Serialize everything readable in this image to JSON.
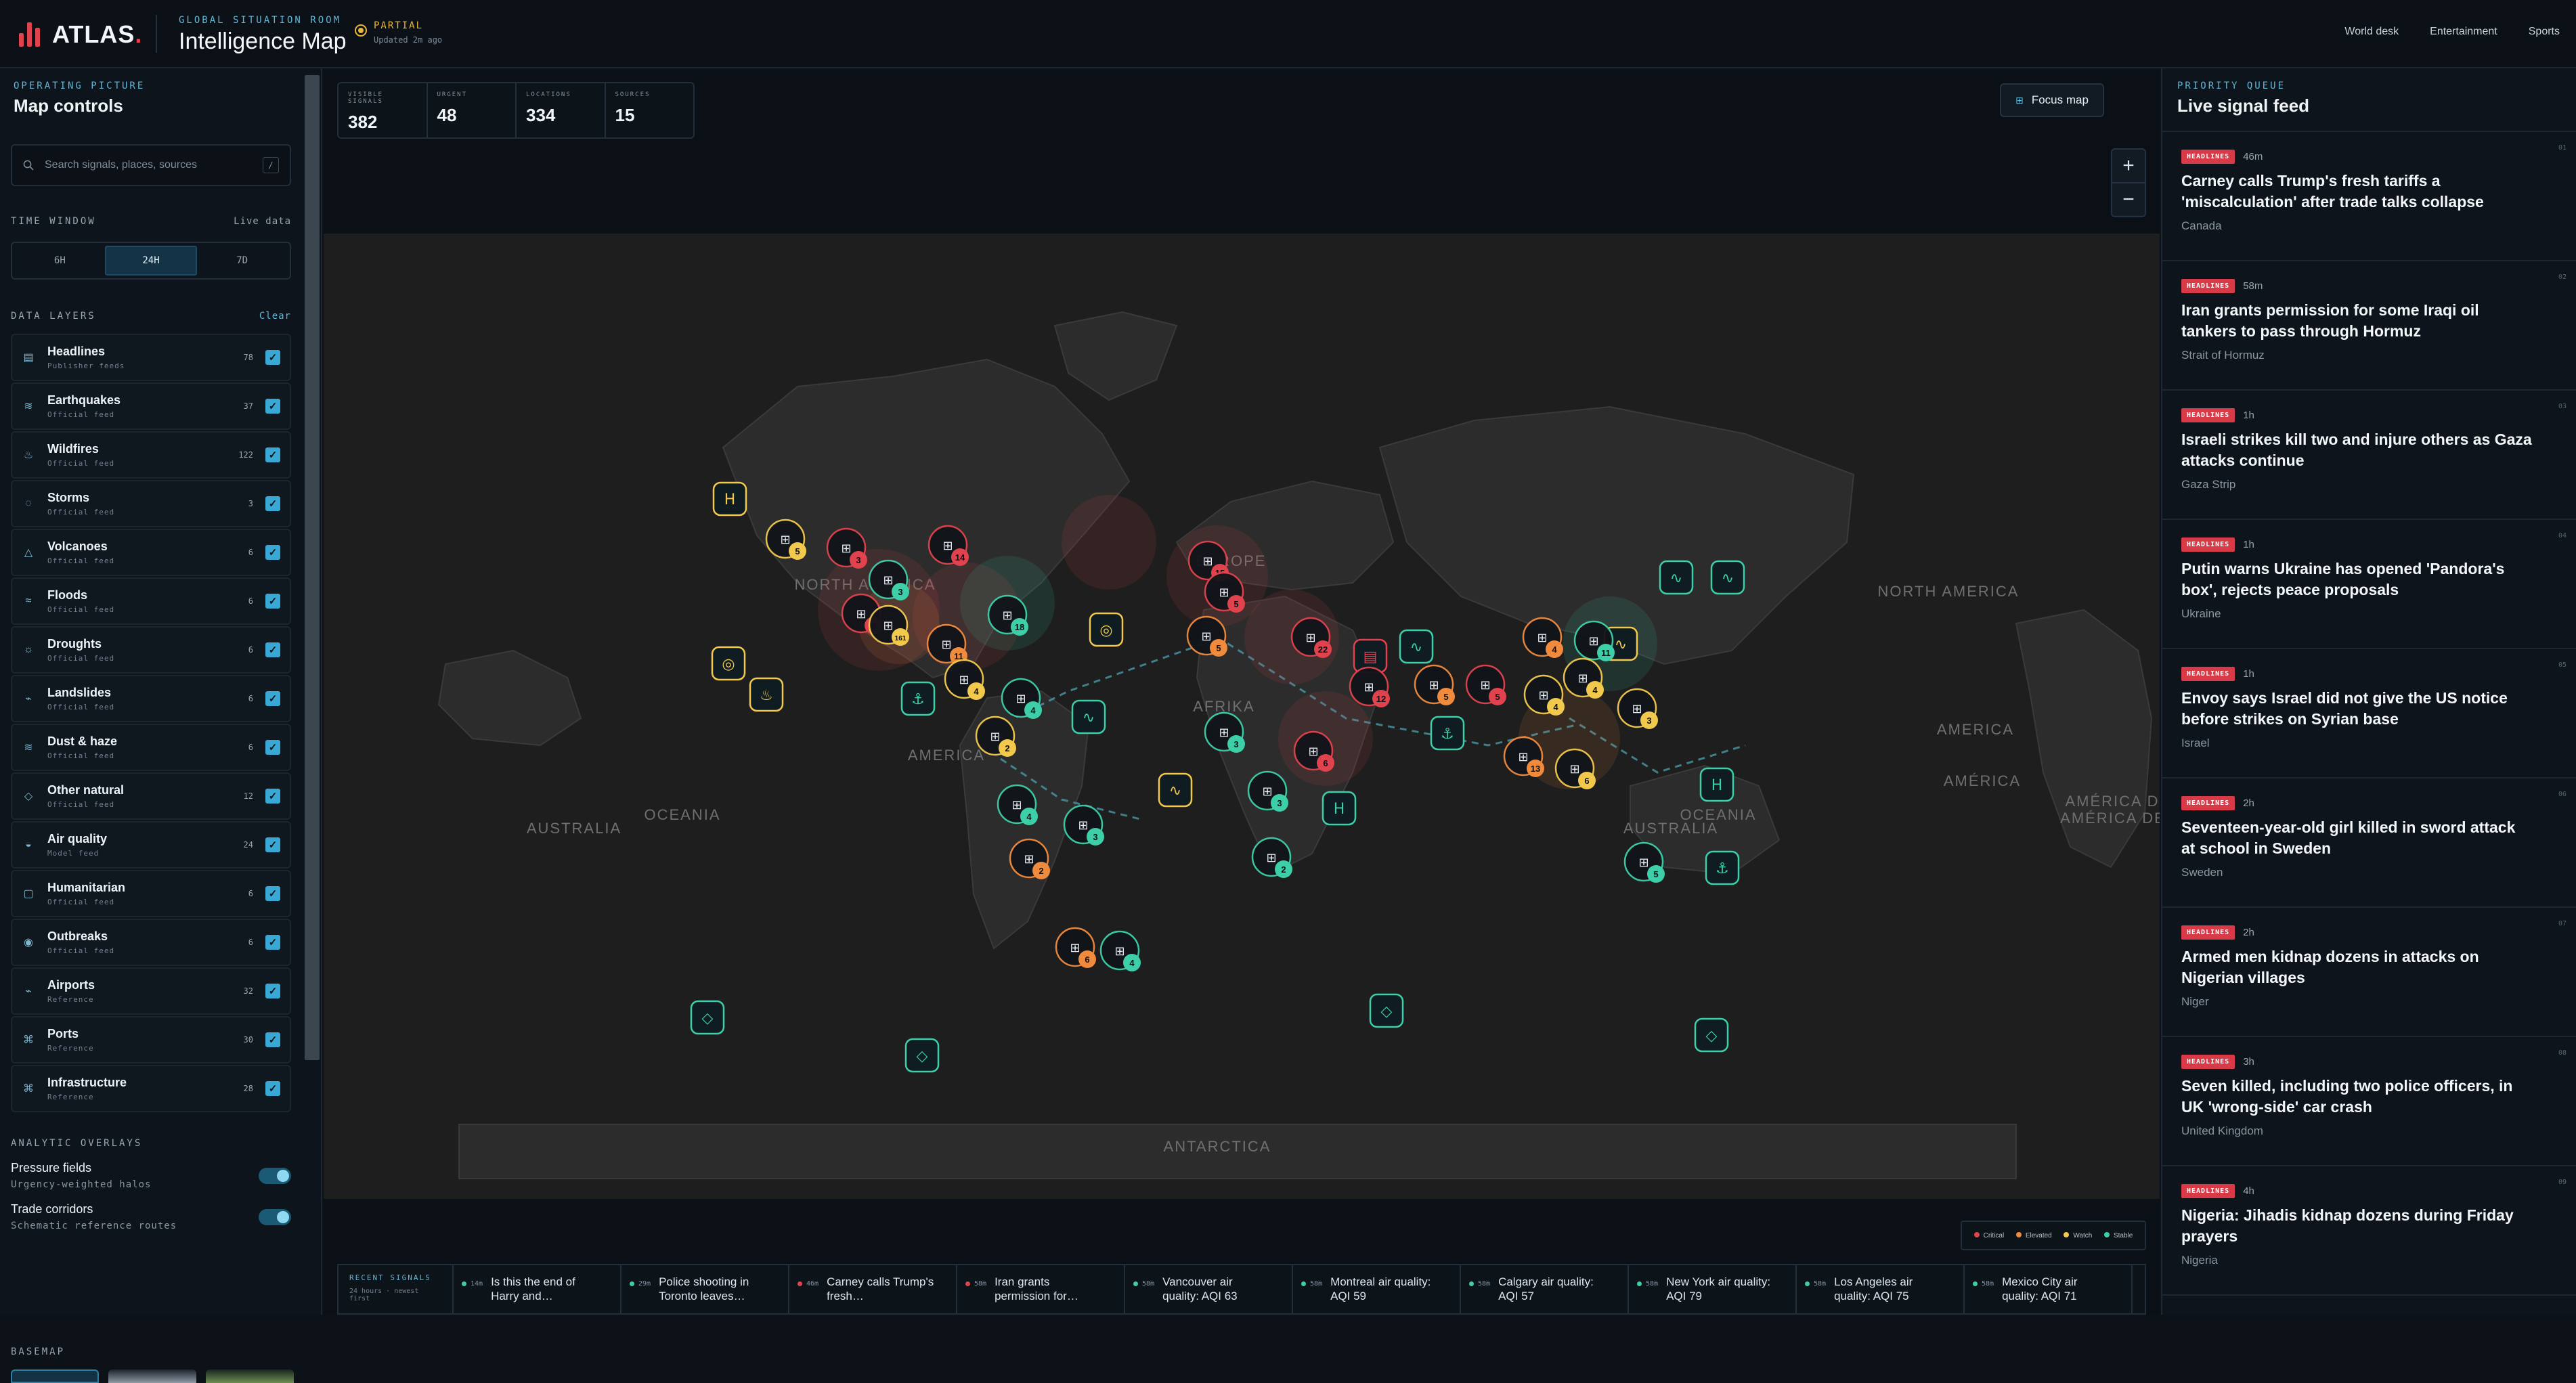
{
  "brand": {
    "name": "ATLAS",
    "dot": "."
  },
  "header": {
    "eyebrow": "GLOBAL SITUATION ROOM",
    "title": "Intelligence Map",
    "status_label": "PARTIAL",
    "status_time": "Updated 2m ago"
  },
  "nav": [
    "World desk",
    "Entertainment",
    "Sports"
  ],
  "sidebar": {
    "eyebrow": "OPERATING PICTURE",
    "title": "Map controls",
    "search_placeholder": "Search signals, places, sources",
    "search_shortcut": "/",
    "time_window": {
      "label": "TIME WINDOW",
      "right": "Live data",
      "options": [
        "6H",
        "24H",
        "7D"
      ],
      "selected": "24H"
    },
    "data_layers": {
      "label": "DATA LAYERS",
      "action": "Clear"
    },
    "layers": [
      {
        "name": "Headlines",
        "sub": "Publisher feeds",
        "count": "78",
        "icon": "newspaper-icon",
        "glyph": "▤"
      },
      {
        "name": "Earthquakes",
        "sub": "Official feed",
        "count": "37",
        "icon": "seismic-icon",
        "glyph": "≋"
      },
      {
        "name": "Wildfires",
        "sub": "Official feed",
        "count": "122",
        "icon": "flame-icon",
        "glyph": "♨"
      },
      {
        "name": "Storms",
        "sub": "Official feed",
        "count": "3",
        "icon": "cyclone-icon",
        "glyph": "◌"
      },
      {
        "name": "Volcanoes",
        "sub": "Official feed",
        "count": "6",
        "icon": "volcano-icon",
        "glyph": "△"
      },
      {
        "name": "Floods",
        "sub": "Official feed",
        "count": "6",
        "icon": "waves-icon",
        "glyph": "≈"
      },
      {
        "name": "Droughts",
        "sub": "Official feed",
        "count": "6",
        "icon": "sun-icon",
        "glyph": "☼"
      },
      {
        "name": "Landslides",
        "sub": "Official feed",
        "count": "6",
        "icon": "landslide-icon",
        "glyph": "⌁"
      },
      {
        "name": "Dust & haze",
        "sub": "Official feed",
        "count": "6",
        "icon": "haze-icon",
        "glyph": "≋"
      },
      {
        "name": "Other natural",
        "sub": "Official feed",
        "count": "12",
        "icon": "diamond-icon",
        "glyph": "◇"
      },
      {
        "name": "Air quality",
        "sub": "Model feed",
        "count": "24",
        "icon": "air-quality-icon",
        "glyph": "◒"
      },
      {
        "name": "Humanitarian",
        "sub": "Official feed",
        "count": "6",
        "icon": "humanitarian-icon",
        "glyph": "▢"
      },
      {
        "name": "Outbreaks",
        "sub": "Official feed",
        "count": "6",
        "icon": "outbreak-icon",
        "glyph": "◉"
      },
      {
        "name": "Airports",
        "sub": "Reference",
        "count": "32",
        "icon": "airport-icon",
        "glyph": "⌁"
      },
      {
        "name": "Ports",
        "sub": "Reference",
        "count": "30",
        "icon": "port-icon",
        "glyph": "⌘"
      },
      {
        "name": "Infrastructure",
        "sub": "Reference",
        "count": "28",
        "icon": "infrastructure-icon",
        "glyph": "⌘"
      }
    ],
    "overlays_label": "ANALYTIC OVERLAYS",
    "overlays": [
      {
        "name": "Pressure fields",
        "sub": "Urgency-weighted halos"
      },
      {
        "name": "Trade corridors",
        "sub": "Schematic reference routes"
      }
    ],
    "basemap_label": "BASEMAP"
  },
  "stats": [
    {
      "label": "VISIBLE SIGNALS",
      "value": "382"
    },
    {
      "label": "URGENT",
      "value": "48"
    },
    {
      "label": "LOCATIONS",
      "value": "334"
    },
    {
      "label": "SOURCES",
      "value": "15"
    }
  ],
  "map": {
    "focus_label": "Focus map",
    "zoom_in": "+",
    "zoom_out": "−",
    "region_labels": [
      "NORTH AMERICA",
      "NORTH AMERICA",
      "AUSTRALIA",
      "OCEANIA",
      "AUSTRALIA",
      "OCEANIA",
      "AMERICA",
      "AMÉRICA DO SUL",
      "AMÉRICA DEL SUR",
      "ANTARCTICA",
      "EUROPE",
      "AFRIKA",
      "AMERICA",
      "AMÉRICA"
    ],
    "legend": [
      {
        "label": "Critical",
        "color": "#e0434e"
      },
      {
        "label": "Elevated",
        "color": "#f08a3c"
      },
      {
        "label": "Watch",
        "color": "#f2c94c"
      },
      {
        "label": "Stable",
        "color": "#3ccfa8"
      }
    ]
  },
  "ticker": {
    "label": "RECENT SIGNALS",
    "sub": "24 hours · newest first",
    "items": [
      {
        "age": "14m",
        "text": "Is this the end of Harry and…",
        "color": "#3ccfa8"
      },
      {
        "age": "29m",
        "text": "Police shooting in Toronto leaves…",
        "color": "#3ccfa8"
      },
      {
        "age": "46m",
        "text": "Carney calls Trump's fresh…",
        "color": "#e0434e"
      },
      {
        "age": "58m",
        "text": "Iran grants permission for…",
        "color": "#e0434e"
      },
      {
        "age": "58m",
        "text": "Vancouver air quality: AQI 63",
        "color": "#3ccfa8"
      },
      {
        "age": "58m",
        "text": "Montreal air quality: AQI 59",
        "color": "#3ccfa8"
      },
      {
        "age": "58m",
        "text": "Calgary air quality: AQI 57",
        "color": "#3ccfa8"
      },
      {
        "age": "58m",
        "text": "New York air quality: AQI 79",
        "color": "#3ccfa8"
      },
      {
        "age": "58m",
        "text": "Los Angeles air quality: AQI 75",
        "color": "#3ccfa8"
      },
      {
        "age": "58m",
        "text": "Mexico City air quality: AQI 71",
        "color": "#3ccfa8"
      }
    ]
  },
  "feed": {
    "eyebrow": "PRIORITY QUEUE",
    "title": "Live signal feed",
    "items": [
      {
        "num": "01",
        "badge": "HEADLINES",
        "age": "46m",
        "headline": "Carney calls Trump's fresh tariffs a 'miscalculation' after trade talks collapse",
        "location": "Canada"
      },
      {
        "num": "02",
        "badge": "HEADLINES",
        "age": "58m",
        "headline": "Iran grants permission for some Iraqi oil tankers to pass through Hormuz",
        "location": "Strait of Hormuz"
      },
      {
        "num": "03",
        "badge": "HEADLINES",
        "age": "1h",
        "headline": "Israeli strikes kill two and injure others as Gaza attacks continue",
        "location": "Gaza Strip"
      },
      {
        "num": "04",
        "badge": "HEADLINES",
        "age": "1h",
        "headline": "Putin warns Ukraine has opened 'Pandora's box', rejects peace proposals",
        "location": "Ukraine"
      },
      {
        "num": "05",
        "badge": "HEADLINES",
        "age": "1h",
        "headline": "Envoy says Israel did not give the US notice before strikes on Syrian base",
        "location": "Israel"
      },
      {
        "num": "06",
        "badge": "HEADLINES",
        "age": "2h",
        "headline": "Seventeen-year-old girl killed in sword attack at school in Sweden",
        "location": "Sweden"
      },
      {
        "num": "07",
        "badge": "HEADLINES",
        "age": "2h",
        "headline": "Armed men kidnap dozens in attacks on Nigerian villages",
        "location": "Niger"
      },
      {
        "num": "08",
        "badge": "HEADLINES",
        "age": "3h",
        "headline": "Seven killed, including two police officers, in UK 'wrong-side' car crash",
        "location": "United Kingdom"
      },
      {
        "num": "09",
        "badge": "HEADLINES",
        "age": "4h",
        "headline": "Nigeria: Jihadis kidnap dozens during Friday prayers",
        "location": "Nigeria"
      }
    ]
  },
  "markers": [
    {
      "count": "5",
      "sev": "watch"
    },
    {
      "count": "3",
      "sev": "critical"
    },
    {
      "count": "3",
      "sev": "stable"
    },
    {
      "count": "14",
      "sev": "critical"
    },
    {
      "count": "3",
      "sev": "critical"
    },
    {
      "count": "161",
      "sev": "watch"
    },
    {
      "count": "11",
      "sev": "elevated"
    },
    {
      "count": "18",
      "sev": "stable"
    },
    {
      "count": "4",
      "sev": "watch"
    },
    {
      "count": "4",
      "sev": "stable"
    },
    {
      "count": "2",
      "sev": "watch"
    },
    {
      "count": "4",
      "sev": "stable"
    },
    {
      "count": "3",
      "sev": "stable"
    },
    {
      "count": "2",
      "sev": "elevated"
    },
    {
      "count": "6",
      "sev": "elevated"
    },
    {
      "count": "4",
      "sev": "stable"
    },
    {
      "count": "15",
      "sev": "critical"
    },
    {
      "count": "5",
      "sev": "critical"
    },
    {
      "count": "5",
      "sev": "elevated"
    },
    {
      "count": "22",
      "sev": "critical"
    },
    {
      "count": "3",
      "sev": "stable"
    },
    {
      "count": "6",
      "sev": "critical"
    },
    {
      "count": "3",
      "sev": "stable"
    },
    {
      "count": "2",
      "sev": "stable"
    },
    {
      "count": "12",
      "sev": "critical"
    },
    {
      "count": "5",
      "sev": "elevated"
    },
    {
      "count": "5",
      "sev": "critical"
    },
    {
      "count": "4",
      "sev": "elevated"
    },
    {
      "count": "4",
      "sev": "watch"
    },
    {
      "count": "11",
      "sev": "stable"
    },
    {
      "count": "4",
      "sev": "watch"
    },
    {
      "count": "3",
      "sev": "watch"
    },
    {
      "count": "13",
      "sev": "elevated"
    },
    {
      "count": "6",
      "sev": "watch"
    },
    {
      "count": "5",
      "sev": "stable"
    }
  ]
}
